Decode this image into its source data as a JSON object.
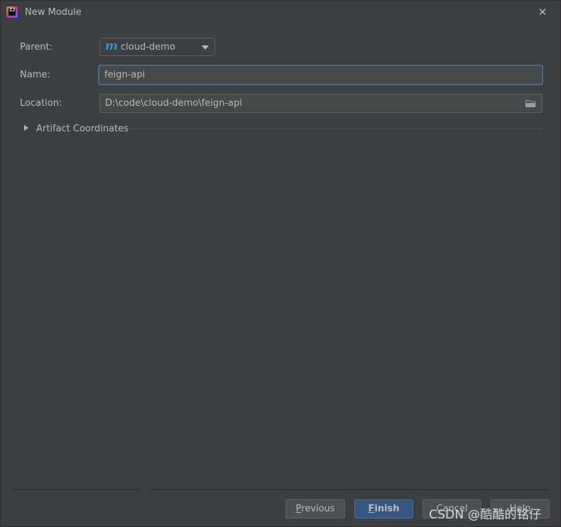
{
  "window": {
    "title": "New Module"
  },
  "form": {
    "parent_label": "Parent:",
    "parent_value": "cloud-demo",
    "name_label": "Name:",
    "name_value": "feign-api",
    "location_label": "Location:",
    "location_value": "D:\\code\\cloud-demo\\feign-api"
  },
  "artifact": {
    "label": "Artifact Coordinates",
    "expanded": false
  },
  "buttons": {
    "previous_mnemonic": "P",
    "previous_rest": "revious",
    "finish_mnemonic": "F",
    "finish_rest": "inish",
    "cancel": "Cancel",
    "help": "Help"
  },
  "watermark": "CSDN @酷酷的铭仔",
  "icons": {
    "app": "intellij-idea-icon",
    "parent": "maven-icon",
    "location_browse": "folder-icon",
    "close": "close-icon",
    "expand": "chevron-right-icon"
  },
  "colors": {
    "background": "#3c3f41",
    "text": "#bbbbbb",
    "focus_border": "#466d94",
    "default_button": "#365880",
    "maven": "#3592c4"
  }
}
